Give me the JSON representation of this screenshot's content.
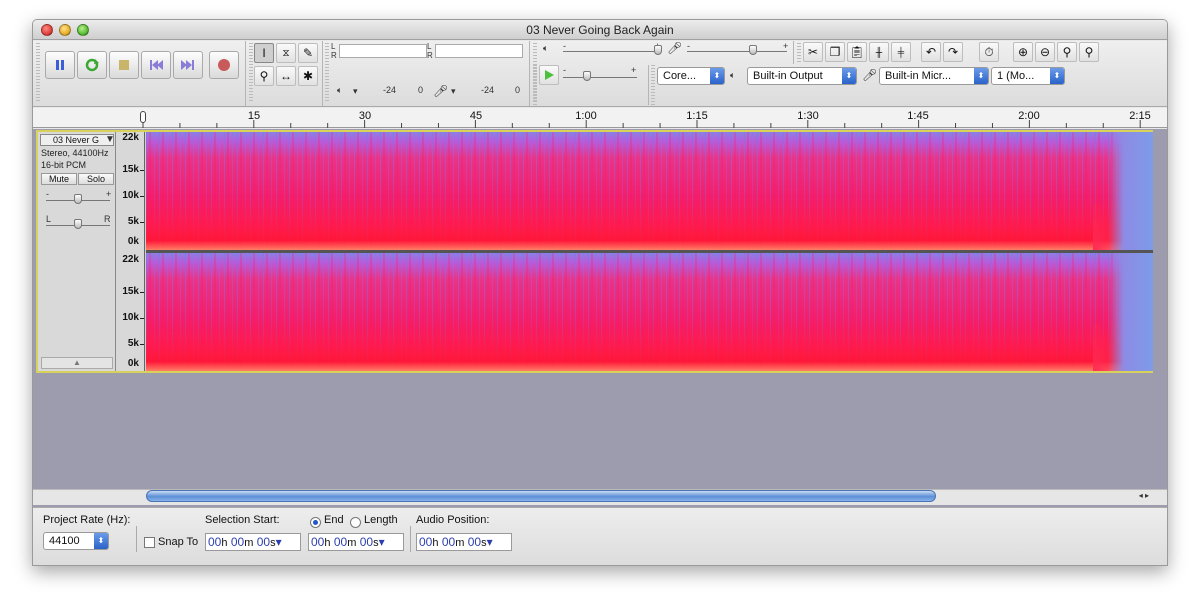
{
  "window": {
    "title": "03 Never Going Back Again"
  },
  "transport": {
    "pause": "pause-icon",
    "loop": "loop-icon",
    "stop": "stop-icon",
    "skip_start": "skip-start-icon",
    "skip_end": "skip-end-icon",
    "record": "record-icon"
  },
  "meters": {
    "play": {
      "l": "L",
      "r": "R",
      "marks": [
        "-24",
        "0"
      ]
    },
    "record": {
      "l": "L",
      "r": "R",
      "marks": [
        "-24",
        "0"
      ]
    }
  },
  "mixer": {
    "minus": "-",
    "plus": "+"
  },
  "devices": {
    "host": "Core...",
    "output": "Built-in Output",
    "input": "Built-in Micr...",
    "channels": "1 (Mo..."
  },
  "ruler": {
    "labels": [
      "0",
      "15",
      "30",
      "45",
      "1:00",
      "1:15",
      "1:30",
      "1:45",
      "2:00",
      "2:15"
    ]
  },
  "track": {
    "name": "03 Never G",
    "info1": "Stereo, 44100Hz",
    "info2": "16-bit PCM",
    "mute": "Mute",
    "solo": "Solo",
    "gain_minus": "-",
    "gain_plus": "+",
    "pan_l": "L",
    "pan_r": "R",
    "freq_labels": [
      "22k",
      "15k",
      "10k",
      "5k",
      "0k"
    ]
  },
  "selection": {
    "project_rate_label": "Project Rate (Hz):",
    "project_rate": "44100",
    "snap_to": "Snap To",
    "selection_start_label": "Selection Start:",
    "end_label": "End",
    "length_label": "Length",
    "audio_position_label": "Audio Position:",
    "start": {
      "h": "00",
      "m": "00",
      "s": "00"
    },
    "end": {
      "h": "00",
      "m": "00",
      "s": "00"
    },
    "position": {
      "h": "00",
      "m": "00",
      "s": "00"
    },
    "units": {
      "h": "h",
      "m": "m",
      "s": "s"
    }
  },
  "colors": {
    "spectrogram_hot": "#ff1a4c",
    "spectrogram_cool": "#8a80e6",
    "track_bg": "#9c9cae",
    "selection_outline": "#d8d25a"
  }
}
